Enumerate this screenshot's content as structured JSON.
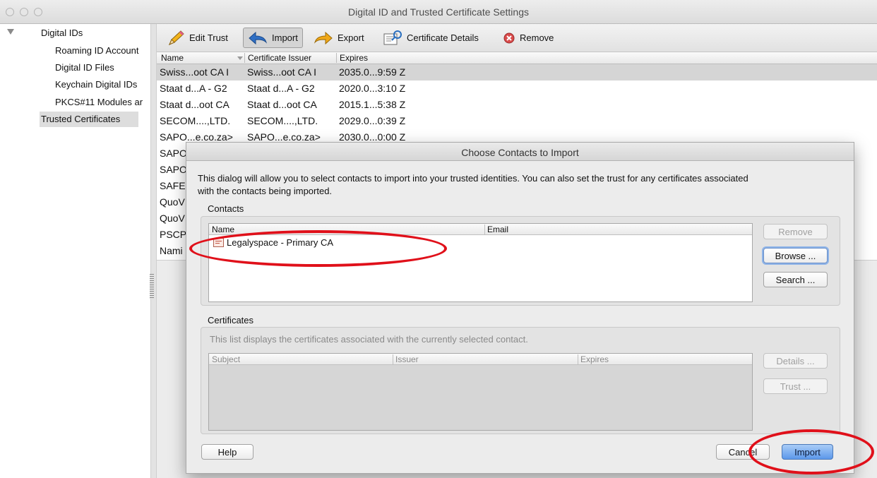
{
  "window": {
    "title": "Digital ID and Trusted Certificate Settings"
  },
  "sidebar": {
    "items": [
      {
        "label": "Digital IDs"
      },
      {
        "label": "Roaming ID Account"
      },
      {
        "label": "Digital ID Files"
      },
      {
        "label": "Keychain Digital IDs"
      },
      {
        "label": "PKCS#11 Modules ar"
      },
      {
        "label": "Trusted Certificates"
      }
    ]
  },
  "toolbar": {
    "edit_trust": "Edit Trust",
    "import": "Import",
    "export": "Export",
    "certificate_details": "Certificate Details",
    "remove": "Remove"
  },
  "cert_table": {
    "columns": [
      "Name",
      "Certificate Issuer",
      "Expires"
    ],
    "rows": [
      {
        "name": "Swiss...oot CA I",
        "issuer": "Swiss...oot CA I",
        "expires": "2035.0...9:59 Z"
      },
      {
        "name": "Staat d...A - G2",
        "issuer": "Staat d...A - G2",
        "expires": "2020.0...3:10 Z"
      },
      {
        "name": "Staat d...oot CA",
        "issuer": "Staat d...oot CA",
        "expires": "2015.1...5:38 Z"
      },
      {
        "name": "SECOM....,LTD.",
        "issuer": "SECOM....,LTD.",
        "expires": "2029.0...0:39 Z"
      },
      {
        "name": "SAPO...e.co.za>",
        "issuer": "SAPO...e.co.za>",
        "expires": "2030.0...0:00 Z"
      },
      {
        "name": "SAPO",
        "issuer": "",
        "expires": ""
      },
      {
        "name": "SAPO",
        "issuer": "",
        "expires": ""
      },
      {
        "name": "SAFE",
        "issuer": "",
        "expires": ""
      },
      {
        "name": "QuoV",
        "issuer": "",
        "expires": ""
      },
      {
        "name": "QuoV",
        "issuer": "",
        "expires": ""
      },
      {
        "name": "PSCP",
        "issuer": "",
        "expires": ""
      },
      {
        "name": "Nami",
        "issuer": "",
        "expires": ""
      }
    ]
  },
  "dialog": {
    "title": "Choose Contacts to Import",
    "description_line1": "This dialog will allow you to select contacts to import into your trusted identities. You can also set the trust for any certificates associated",
    "description_line2": "with the contacts being imported.",
    "contacts": {
      "label": "Contacts",
      "columns": [
        "Name",
        "Email"
      ],
      "items": [
        {
          "name": "Legalyspace - Primary CA",
          "email": ""
        }
      ],
      "remove_button": "Remove",
      "browse_button": "Browse ...",
      "search_button": "Search ..."
    },
    "certificates": {
      "label": "Certificates",
      "description": "This list displays the certificates associated with the currently selected contact.",
      "columns": [
        "Subject",
        "Issuer",
        "Expires"
      ],
      "details_button": "Details ...",
      "trust_button": "Trust ..."
    },
    "help_button": "Help",
    "cancel_button": "Cancel",
    "import_button": "Import"
  },
  "colors": {
    "annotation": "#e0101a",
    "primary_button": "#5c98ea"
  }
}
